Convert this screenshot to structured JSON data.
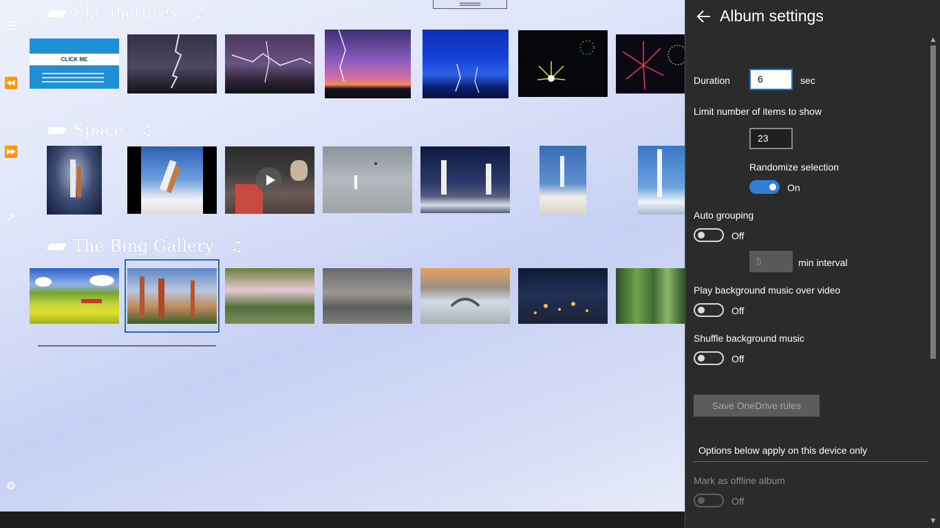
{
  "gallery": {
    "sections": [
      {
        "title": "Sky Pictures"
      },
      {
        "title": "Space"
      },
      {
        "title": "The Bing Gallery"
      }
    ],
    "click_me_label": "CLICK ME"
  },
  "panel": {
    "title": "Album settings",
    "duration": {
      "label": "Duration",
      "value": "6",
      "unit": "sec"
    },
    "limit": {
      "label": "Limit number of items to show",
      "value": "23"
    },
    "randomize": {
      "label": "Randomize selection",
      "state": "On"
    },
    "auto_grouping": {
      "label": "Auto grouping",
      "state": "Off",
      "interval_value": "5",
      "interval_unit": "min interval"
    },
    "play_bg_music": {
      "label": "Play background music over video",
      "state": "Off"
    },
    "shuffle_music": {
      "label": "Shuffle background music",
      "state": "Off"
    },
    "save_button": "Save OneDrive rules",
    "device_note": "Options below apply on this device only",
    "offline": {
      "label": "Mark as offline album",
      "state": "Off"
    }
  },
  "colors": {
    "accent": "#2f7fd6",
    "panel_bg": "#2b2b2b"
  }
}
